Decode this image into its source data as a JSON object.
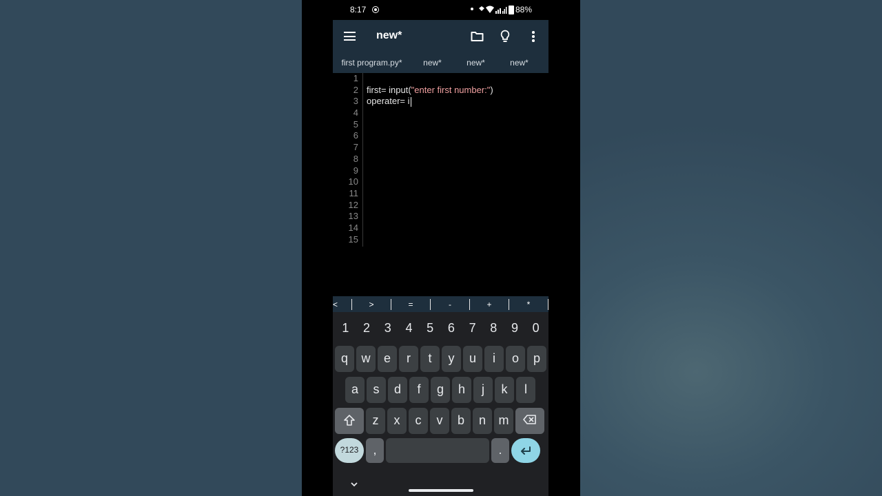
{
  "status": {
    "time": "8:17",
    "battery": "88%"
  },
  "toolbar": {
    "title": "new*"
  },
  "tabs": [
    {
      "label": "first program.py*"
    },
    {
      "label": "new*"
    },
    {
      "label": "new*"
    },
    {
      "label": "new*"
    }
  ],
  "editor": {
    "line_numbers": [
      "1",
      "2",
      "3",
      "4",
      "5",
      "6",
      "7",
      "8",
      "9",
      "10",
      "11",
      "12",
      "13",
      "14",
      "15"
    ],
    "line2_code": "first= input(",
    "line2_string": "\"enter first number:\"",
    "line2_end": ")",
    "line3_code": "operater= i"
  },
  "symbols": [
    "<",
    ">",
    "=",
    "-",
    "+",
    "*"
  ],
  "keyboard": {
    "numbers": [
      "1",
      "2",
      "3",
      "4",
      "5",
      "6",
      "7",
      "8",
      "9",
      "0"
    ],
    "row1": [
      "q",
      "w",
      "e",
      "r",
      "t",
      "y",
      "u",
      "i",
      "o",
      "p"
    ],
    "row2": [
      "a",
      "s",
      "d",
      "f",
      "g",
      "h",
      "j",
      "k",
      "l"
    ],
    "row3": [
      "z",
      "x",
      "c",
      "v",
      "b",
      "n",
      "m"
    ],
    "sym_key": "?123",
    "comma": ",",
    "period": "."
  },
  "colors": {
    "toolbar_bg": "#1e2f3d",
    "fab": "#f7d64a",
    "string": "#f0a0a0",
    "enter_key": "#8fd5e6"
  }
}
